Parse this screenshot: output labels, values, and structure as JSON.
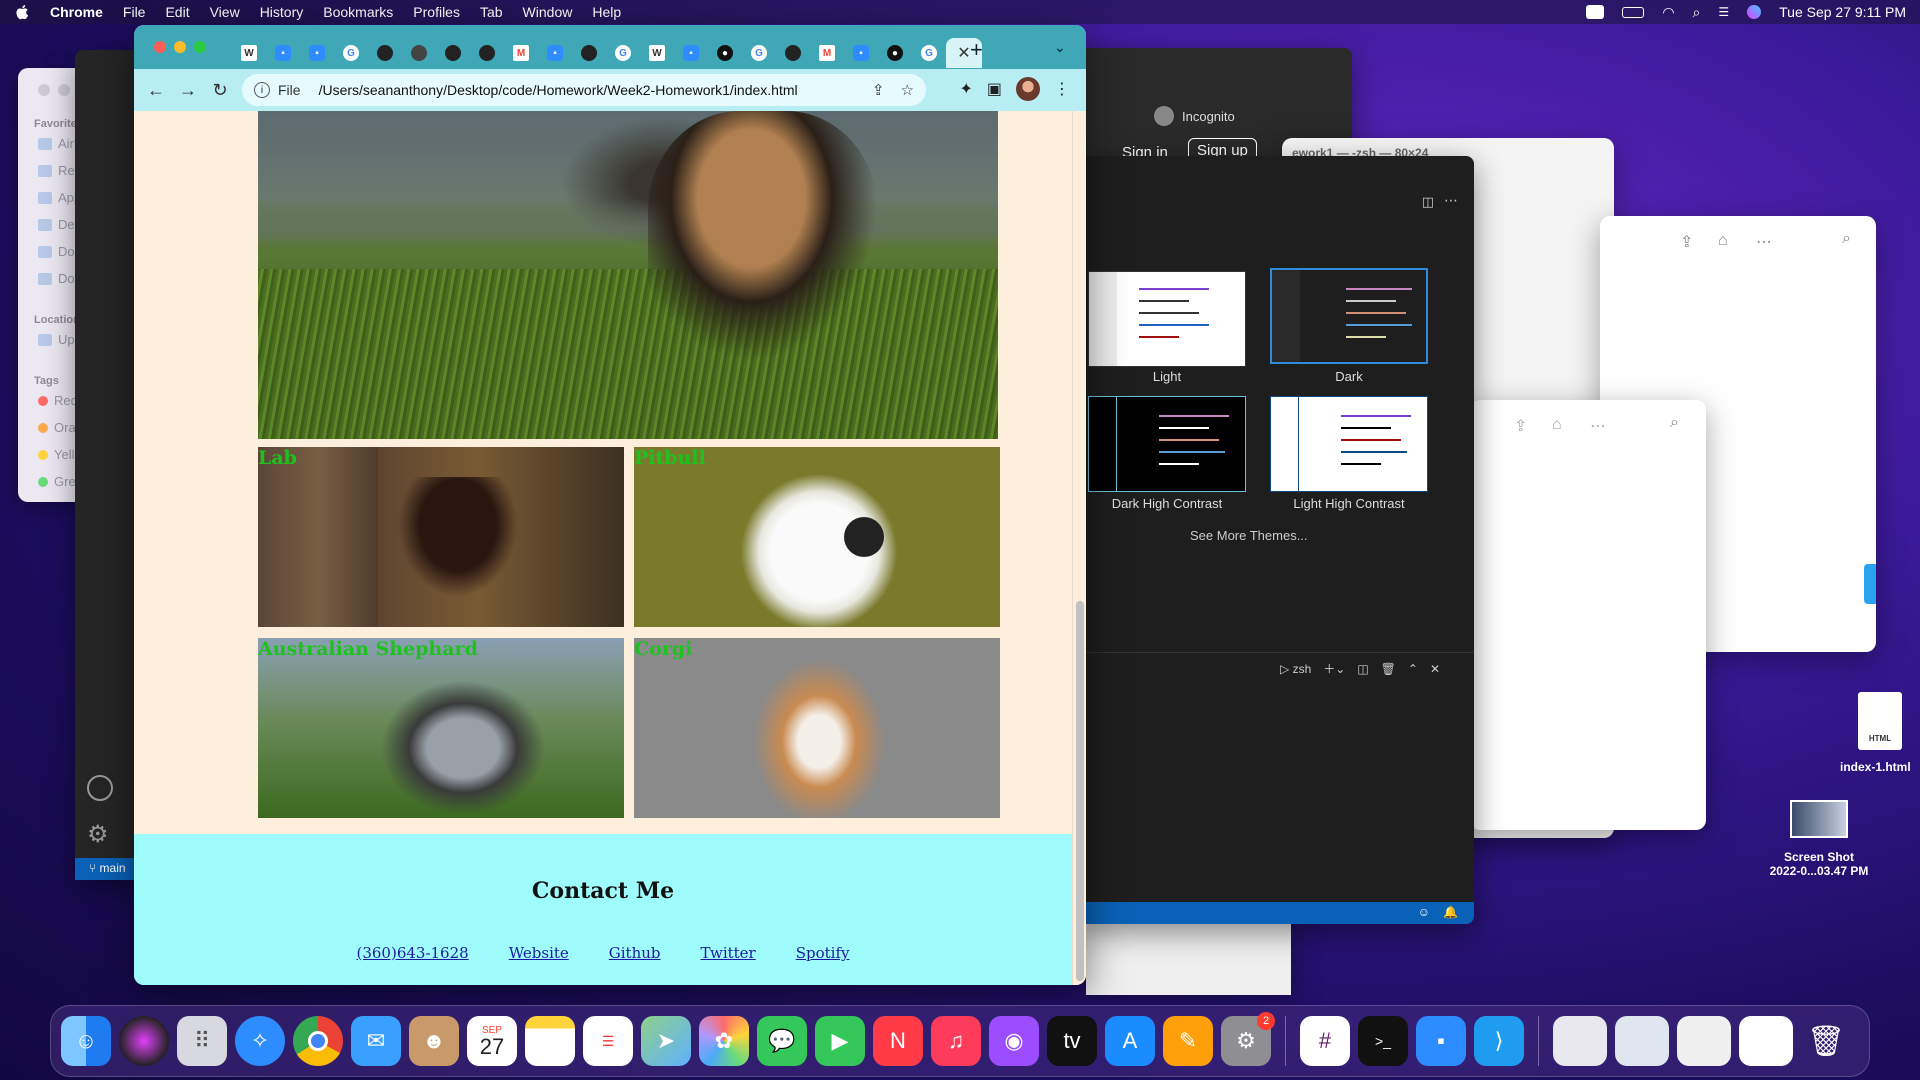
{
  "menubar": {
    "app": "Chrome",
    "items": [
      "File",
      "Edit",
      "View",
      "History",
      "Bookmarks",
      "Profiles",
      "Tab",
      "Window",
      "Help"
    ],
    "clock": "Tue Sep 27  9:11 PM"
  },
  "finder": {
    "favorites_label": "Favorites",
    "favorites": [
      "AirDrop",
      "Recents",
      "Applicati...",
      "Desktop",
      "Documents",
      "Downloads"
    ],
    "locations_label": "Locations",
    "locations": [
      "Update"
    ],
    "tags_label": "Tags",
    "tags": [
      {
        "label": "Red",
        "color": "#ff6b6b"
      },
      {
        "label": "Orange",
        "color": "#ffa94d"
      },
      {
        "label": "Yellow",
        "color": "#ffd43b"
      },
      {
        "label": "Green",
        "color": "#69db7c"
      }
    ]
  },
  "incognito_window": {
    "incognito_label": "Incognito",
    "sign_in": "Sign in",
    "sign_up": "Sign up"
  },
  "terminal": {
    "title": "ework1 — -zsh — 80×24"
  },
  "vscode": {
    "themes": [
      {
        "label": "Light"
      },
      {
        "label": "Dark"
      },
      {
        "label": "Dark High Contrast"
      },
      {
        "label": "Light High Contrast"
      }
    ],
    "see_more": "See More Themes...",
    "terminal_tab": "zsh",
    "branch": "main"
  },
  "chrome": {
    "scheme_label": "File",
    "url": "/Users/seananthony/Desktop/code/Homework/Week2-Homework1/index.html",
    "colors": {
      "tabstrip": "#3fa7b6",
      "toolbar": "#b8eef3"
    }
  },
  "page": {
    "cards": [
      {
        "label": "Lab"
      },
      {
        "label": "Pitbull"
      },
      {
        "label": "Australian Shephard"
      },
      {
        "label": "Corgi"
      }
    ],
    "contact_title": "Contact Me",
    "links": [
      "(360)643-1628",
      "Website",
      "Github",
      "Twitter",
      "Spotify"
    ],
    "label_color": "#1ec21e",
    "footer_color": "#9ffcfc"
  },
  "desktop": {
    "files": [
      {
        "label": "index-1.html",
        "kind": "HTML"
      },
      {
        "label": "Screen Shot\n2022-0...03.47 PM"
      }
    ]
  },
  "dock": {
    "calendar_month": "SEP",
    "calendar_day": "27",
    "settings_badge": "2"
  }
}
